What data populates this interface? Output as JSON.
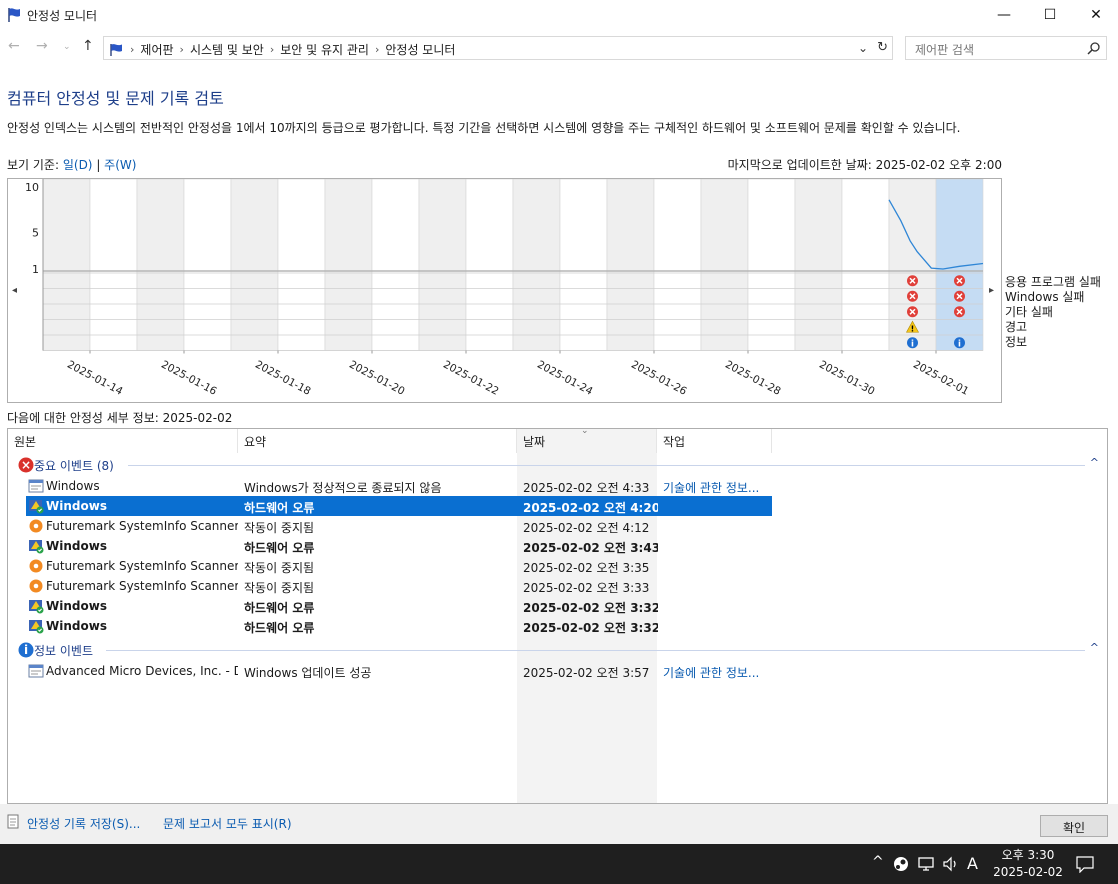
{
  "window": {
    "title": "안정성 모니터",
    "minimize_glyph": "—",
    "maximize_glyph": "☐",
    "close_glyph": "✕"
  },
  "address": {
    "crumbs": [
      "제어판",
      "시스템 및 보안",
      "보안 및 유지 관리",
      "안정성 모니터"
    ],
    "search_placeholder": "제어판 검색"
  },
  "page": {
    "heading": "컴퓨터 안정성 및 문제 기록 검토",
    "description": "안정성 인덱스는 시스템의 전반적인 안정성을 1에서 10까지의 등급으로 평가합니다. 특정 기간을 선택하면 시스템에 영향을 주는 구체적인 하드웨어 및 소프트웨어 문제를 확인할 수 있습니다.",
    "view_by_label": "보기 기준: ",
    "view_day": "일(D)",
    "view_separator": " | ",
    "view_week": "주(W)",
    "last_updated": "마지막으로 업데이트한 날짜: 2025-02-02 오후 2:00"
  },
  "chart_data": {
    "type": "line",
    "title": "",
    "ylabel": "",
    "ylim": [
      1,
      10
    ],
    "y_ticks": [
      "10",
      "5",
      "1"
    ],
    "x_labels": [
      "2025-01-14",
      "2025-01-16",
      "2025-01-18",
      "2025-01-20",
      "2025-01-22",
      "2025-01-24",
      "2025-01-26",
      "2025-01-28",
      "2025-01-30",
      "2025-02-01"
    ],
    "row_labels": [
      "응용 프로그램 실패",
      "Windows 실패",
      "기타 실패",
      "경고",
      "정보"
    ],
    "columns_shown": 20,
    "stability_line": {
      "x": [
        "2025-02-01",
        "2025-02-01",
        "2025-02-01",
        "2025-02-01",
        "2025-02-01",
        "2025-02-02",
        "2025-02-02",
        "2025-02-02"
      ],
      "day_fraction": [
        0.0,
        0.25,
        0.45,
        0.6,
        0.9,
        0.15,
        0.5,
        1.0
      ],
      "y": [
        8.6,
        6.3,
        4.1,
        2.9,
        1.1,
        1.0,
        1.3,
        1.6
      ]
    },
    "markers": [
      {
        "date": "2025-02-01",
        "row": "응용 프로그램 실패",
        "kind": "error"
      },
      {
        "date": "2025-02-01",
        "row": "Windows 실패",
        "kind": "error"
      },
      {
        "date": "2025-02-01",
        "row": "기타 실패",
        "kind": "error"
      },
      {
        "date": "2025-02-01",
        "row": "경고",
        "kind": "warning"
      },
      {
        "date": "2025-02-01",
        "row": "정보",
        "kind": "info"
      },
      {
        "date": "2025-02-02",
        "row": "응용 프로그램 실패",
        "kind": "error"
      },
      {
        "date": "2025-02-02",
        "row": "Windows 실패",
        "kind": "error"
      },
      {
        "date": "2025-02-02",
        "row": "기타 실패",
        "kind": "error"
      },
      {
        "date": "2025-02-02",
        "row": "정보",
        "kind": "info"
      }
    ],
    "selected_date": "2025-02-02",
    "colors": {
      "line": "#2f86d6",
      "selected": "#c5dcf3",
      "shaded": "#efefef",
      "error": "#e0403a",
      "warning": "#f5c518",
      "info": "#1f6fd1"
    }
  },
  "details": {
    "title": "다음에 대한 안정성 세부 정보: 2025-02-02",
    "columns": [
      "원본",
      "요약",
      "날짜",
      "작업"
    ],
    "groups": [
      {
        "title": "중요 이벤트 (8)",
        "icon": "error-icon",
        "rows": [
          {
            "source": "Windows",
            "summary": "Windows가 정상적으로 종료되지 않음",
            "date": "2025-02-02 오전 4:33",
            "action": "기술에 관한 정보...",
            "icon": "app-window-icon",
            "style": "normal"
          },
          {
            "source": "Windows",
            "summary": "하드웨어 오류",
            "date": "2025-02-02 오전 4:20",
            "action": "",
            "icon": "hardware-error-icon",
            "style": "selected"
          },
          {
            "source": "Futuremark SystemInfo Scanner",
            "summary": "작동이 중지됨",
            "date": "2025-02-02 오전 4:12",
            "action": "",
            "icon": "futuremark-icon",
            "style": "normal"
          },
          {
            "source": "Windows",
            "summary": "하드웨어 오류",
            "date": "2025-02-02 오전 3:43",
            "action": "",
            "icon": "hardware-error-icon",
            "style": "bold"
          },
          {
            "source": "Futuremark SystemInfo Scanner",
            "summary": "작동이 중지됨",
            "date": "2025-02-02 오전 3:35",
            "action": "",
            "icon": "futuremark-icon",
            "style": "normal"
          },
          {
            "source": "Futuremark SystemInfo Scanner",
            "summary": "작동이 중지됨",
            "date": "2025-02-02 오전 3:33",
            "action": "",
            "icon": "futuremark-icon",
            "style": "normal"
          },
          {
            "source": "Windows",
            "summary": "하드웨어 오류",
            "date": "2025-02-02 오전 3:32",
            "action": "",
            "icon": "hardware-error-icon",
            "style": "bold"
          },
          {
            "source": "Windows",
            "summary": "하드웨어 오류",
            "date": "2025-02-02 오전 3:32",
            "action": "",
            "icon": "hardware-error-icon",
            "style": "bold"
          }
        ]
      },
      {
        "title": "정보 이벤트",
        "icon": "info-icon",
        "rows": [
          {
            "source": "Advanced Micro Devices, Inc. - D...",
            "summary": "Windows 업데이트 성공",
            "date": "2025-02-02 오전 3:57",
            "action": "기술에 관한 정보...",
            "icon": "app-window-icon",
            "style": "normal"
          }
        ]
      }
    ]
  },
  "footer": {
    "save_history": "안정성 기록 저장(S)...",
    "show_all_reports": "문제 보고서 모두 표시(R)",
    "ok_button": "확인"
  },
  "taskbar": {
    "time": "오후 3:30",
    "date": "2025-02-02",
    "ime": "A"
  }
}
